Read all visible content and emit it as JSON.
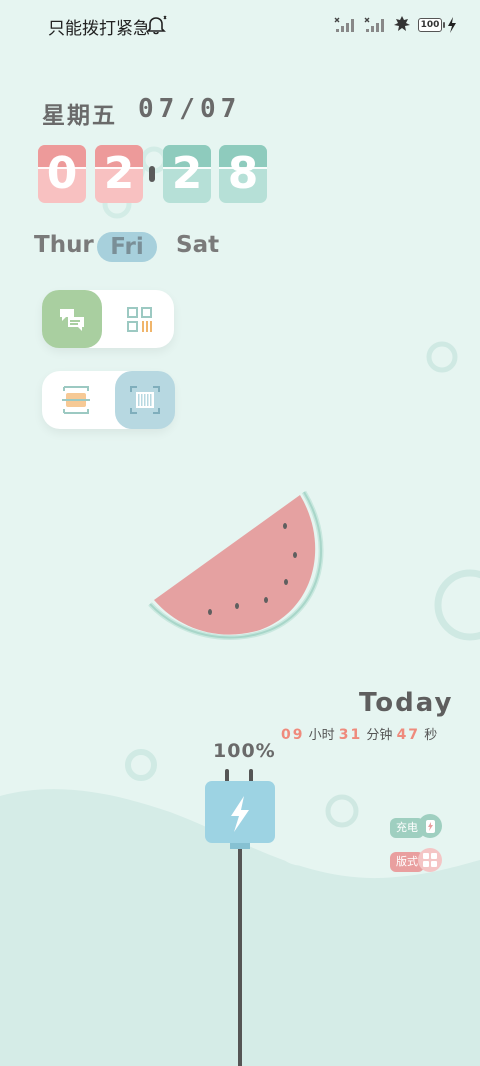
{
  "status_bar": {
    "carrier_text": "只能拨打紧急",
    "battery_level": "100",
    "icons": [
      "bell-icon",
      "no-signal-icon",
      "no-signal-icon",
      "leaf-icon",
      "battery-icon",
      "charging-bolt-icon"
    ]
  },
  "date": {
    "weekday": "星期五",
    "date": "07/07"
  },
  "clock": {
    "hour_tens": "0",
    "hour_ones": "2",
    "minute_tens": "2",
    "minute_ones": "8"
  },
  "days": {
    "prev": "Thur",
    "current": "Fri",
    "next": "Sat"
  },
  "toggles": [
    {
      "on_icon": "chat-icon",
      "off_icon": "qr-code-icon",
      "state": "left"
    },
    {
      "on_icon": "barcode-scan-icon",
      "off_icon": "card-scan-icon",
      "state": "right"
    }
  ],
  "today": {
    "label": "Today",
    "hours": "09",
    "hours_unit": "小时",
    "minutes": "31",
    "minutes_unit": "分钟",
    "seconds": "47",
    "seconds_unit": "秒"
  },
  "charge_percent": "100%",
  "chips": {
    "charge": "充电",
    "style": "版式"
  },
  "colors": {
    "background": "#e6f5f1",
    "wave": "#d6ece8",
    "red_digit": "#f8c1c1",
    "green_digit": "#b6e0d7",
    "plug": "#9dd3e3",
    "watermelon": "#e8a0a0"
  }
}
